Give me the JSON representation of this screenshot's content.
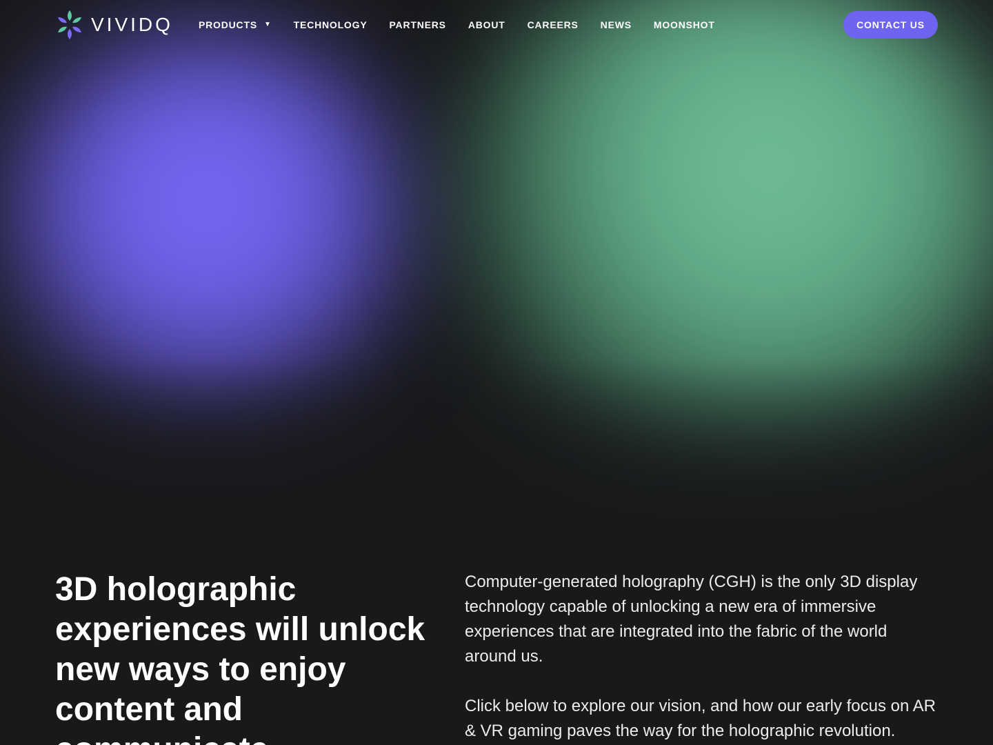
{
  "brand": {
    "name": "VIVIDQ",
    "logo_icon": "flower-logo-icon",
    "colors": {
      "accent": "#6f63f2",
      "green": "#66b08c",
      "background": "#18191b"
    }
  },
  "nav": {
    "items": [
      {
        "label": "PRODUCTS",
        "has_dropdown": true
      },
      {
        "label": "TECHNOLOGY"
      },
      {
        "label": "PARTNERS"
      },
      {
        "label": "ABOUT"
      },
      {
        "label": "CAREERS"
      },
      {
        "label": "NEWS"
      },
      {
        "label": "MOONSHOT"
      }
    ],
    "dropdown_caret": "▼",
    "cta_label": "CONTACT US"
  },
  "hero": {
    "headline": "3D holographic experiences will unlock new ways to enjoy content and communicate",
    "paragraphs": [
      "Computer-generated holography (CGH) is the only 3D display technology capable of unlocking a new era of immersive experiences that are integrated into the fabric of the world around us.",
      "Click below to explore our vision, and how our early focus on AR & VR gaming paves the way for the holographic revolution."
    ]
  }
}
